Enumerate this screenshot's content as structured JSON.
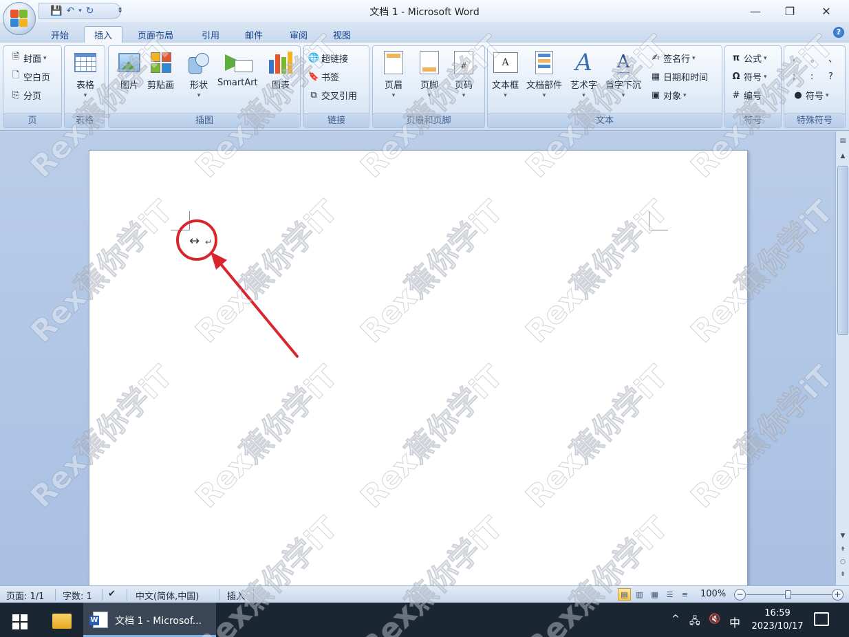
{
  "window": {
    "title": "文档 1 - Microsoft Word",
    "minimize_glyph": "—",
    "maximize_glyph": "❐",
    "close_glyph": "✕"
  },
  "qat": {
    "save_glyph": "💾",
    "undo_glyph": "↶",
    "redo_glyph": "↻",
    "more_glyph": "⇟"
  },
  "tabs": [
    {
      "label": "开始"
    },
    {
      "label": "插入"
    },
    {
      "label": "页面布局"
    },
    {
      "label": "引用"
    },
    {
      "label": "邮件"
    },
    {
      "label": "审阅"
    },
    {
      "label": "视图"
    }
  ],
  "active_tab": "插入",
  "ribbon": {
    "pages": {
      "label": "页",
      "cover": "封面",
      "blank": "空白页",
      "break": "分页"
    },
    "tables": {
      "label": "表格",
      "table": "表格"
    },
    "illustrations": {
      "label": "插图",
      "picture": "图片",
      "clipart": "剪贴画",
      "shapes": "形状",
      "smartart": "SmartArt",
      "chart": "图表"
    },
    "links": {
      "label": "链接",
      "hyperlink": "超链接",
      "bookmark": "书签",
      "crossref": "交叉引用"
    },
    "header_footer": {
      "label": "页眉和页脚",
      "header": "页眉",
      "footer": "页脚",
      "page_number": "页码",
      "page_number_glyph": "#"
    },
    "text": {
      "label": "文本",
      "textbox": "文本框",
      "quickparts": "文档部件",
      "wordart": "艺术字",
      "dropcap": "首字下沉",
      "signature": "签名行",
      "datetime": "日期和时间",
      "object": "对象",
      "textbox_glyph": "A",
      "wordart_glyph": "A",
      "dropcap_glyph": "A"
    },
    "symbols": {
      "label": "符号",
      "equation": "公式",
      "symbol": "符号",
      "numbering": "编号",
      "equation_glyph": "π",
      "symbol_glyph": "Ω"
    },
    "special": {
      "label": "特殊符号",
      "chars": [
        ",",
        "。",
        "、",
        ";",
        ":",
        "?"
      ],
      "symbol": "符号"
    }
  },
  "document": {
    "cursor_glyph": "↔",
    "para_mark": "↵"
  },
  "statusbar": {
    "page": "页面: 1/1",
    "words": "字数: 1",
    "language": "中文(简体,中国)",
    "mode": "插入",
    "zoom": "100%",
    "zoom_level": 1.0
  },
  "taskbar": {
    "app_label": "文档 1 - Microsof...",
    "ime": "中",
    "time": "16:59",
    "date": "2023/10/17",
    "tray_up": "^",
    "volume": "🔇"
  },
  "watermark": "Rex蕉你学iT",
  "colors": {
    "annotation_red": "#d7262e",
    "ribbon_text": "#15428b"
  }
}
